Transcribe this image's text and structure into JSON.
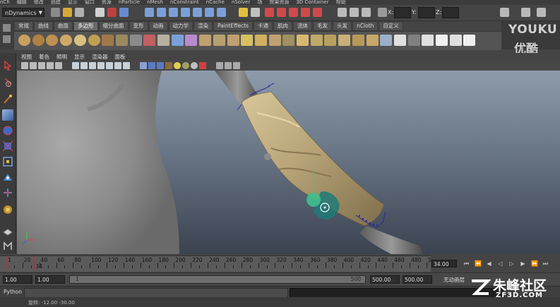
{
  "menubar": {
    "items": [
      "nCh",
      "编辑",
      "修改",
      "创建",
      "显示",
      "窗口",
      "资源",
      "nParticle",
      "nMesh",
      "nConstraint",
      "nCache",
      "nSolver",
      "场",
      "效果资源",
      "3D Container",
      "帮助"
    ]
  },
  "status_line": {
    "mode_menu_value": "nDynamics",
    "coord_labels": [
      "X:",
      "Y:",
      "Z:"
    ]
  },
  "shelf": {
    "tabs": [
      "常规",
      "曲线",
      "曲面",
      "多边形",
      "细分曲面",
      "变形",
      "动画",
      "动力学",
      "渲染",
      "PaintEffects",
      "卡通",
      "肌肉",
      "流体",
      "毛发",
      "头发",
      "nCloth",
      "自定义"
    ],
    "active_tab": "多边形"
  },
  "panel_menu": {
    "items": [
      "视图",
      "着色",
      "照明",
      "显示",
      "渲染器",
      "面板"
    ]
  },
  "timeline": {
    "tick_labels": [
      "1",
      "20",
      "40",
      "60",
      "80",
      "100",
      "120",
      "140",
      "160",
      "180",
      "200",
      "220",
      "240",
      "260",
      "280",
      "300",
      "320",
      "340",
      "360",
      "380",
      "400",
      "420",
      "440",
      "460",
      "480",
      "5"
    ],
    "current_frame": "34",
    "current_time_field": "34.00"
  },
  "range_slider": {
    "start_time": "1.00",
    "playback_start": "1.00",
    "range_start_label": "1",
    "range_end_label": "500",
    "playback_end": "500.00",
    "end_time": "500.00",
    "char_set_label": "无动画层"
  },
  "command_line": {
    "language_label": "Python"
  },
  "help_line": {
    "text": "旋转: -12.00  -30.00"
  },
  "watermarks": {
    "youku_brand": "YOUKU",
    "youku_cn": "优酷",
    "site_title": "朱峰社区",
    "site_url": "ZF3D.COM"
  },
  "colors": {
    "cloth": "#b8a478",
    "manipulator_green": "#3fbf8f",
    "selection_blue": "#2a2a9a",
    "timeline_marker": "#c23030"
  }
}
